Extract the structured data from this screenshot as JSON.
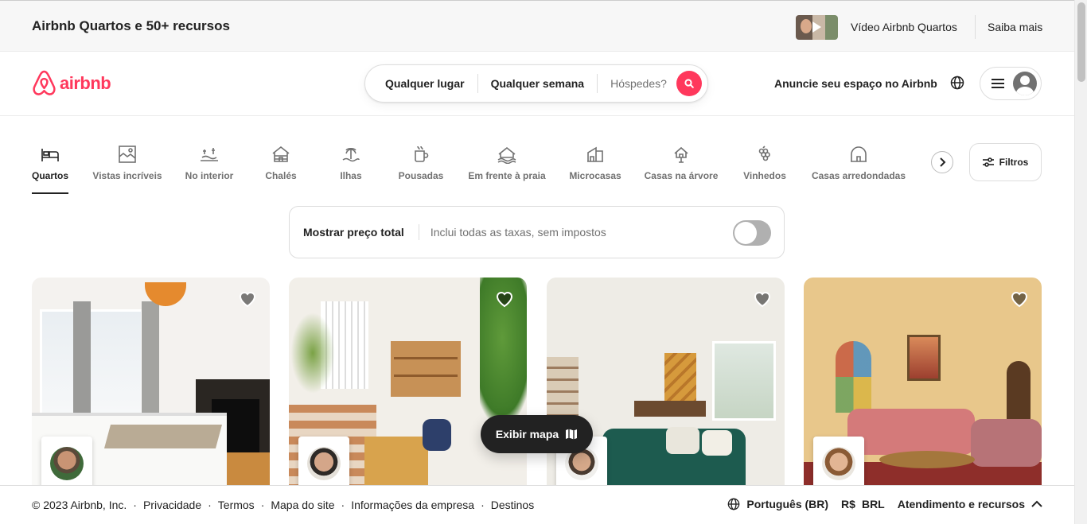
{
  "promo": {
    "title": "Airbnb Quartos e 50+ recursos",
    "video_label": "Vídeo Airbnb Quartos",
    "more_label": "Saiba mais"
  },
  "header": {
    "logo_text": "airbnb",
    "search": {
      "where": "Qualquer lugar",
      "when": "Qualquer semana",
      "guests": "Hóspedes?"
    },
    "host_label": "Anuncie seu espaço no Airbnb"
  },
  "categories": [
    {
      "label": "Quartos",
      "icon": "bed-icon",
      "active": true
    },
    {
      "label": "Vistas incríveis",
      "icon": "landscape-icon"
    },
    {
      "label": "No interior",
      "icon": "countryside-icon"
    },
    {
      "label": "Chalés",
      "icon": "cabin-icon"
    },
    {
      "label": "Ilhas",
      "icon": "island-icon"
    },
    {
      "label": "Pousadas",
      "icon": "mug-icon"
    },
    {
      "label": "Em frente à praia",
      "icon": "beachfront-icon"
    },
    {
      "label": "Microcasas",
      "icon": "tiny-home-icon"
    },
    {
      "label": "Casas na árvore",
      "icon": "treehouse-icon"
    },
    {
      "label": "Vinhedos",
      "icon": "grapes-icon"
    },
    {
      "label": "Casas arredondadas",
      "icon": "dome-icon"
    }
  ],
  "filters_label": "Filtros",
  "total_price": {
    "title": "Mostrar preço total",
    "subtitle": "Inclui todas as taxas, sem impostos",
    "enabled": false
  },
  "map_button_label": "Exibir mapa",
  "footer": {
    "copyright": "© 2023 Airbnb, Inc.",
    "links": [
      "Privacidade",
      "Termos",
      "Mapa do site",
      "Informações da empresa",
      "Destinos"
    ],
    "language": "Português (BR)",
    "currency_symbol": "R$",
    "currency_code": "BRL",
    "support": "Atendimento e recursos"
  },
  "colors": {
    "brand": "#ff385c",
    "text": "#222222",
    "muted": "#717171"
  }
}
